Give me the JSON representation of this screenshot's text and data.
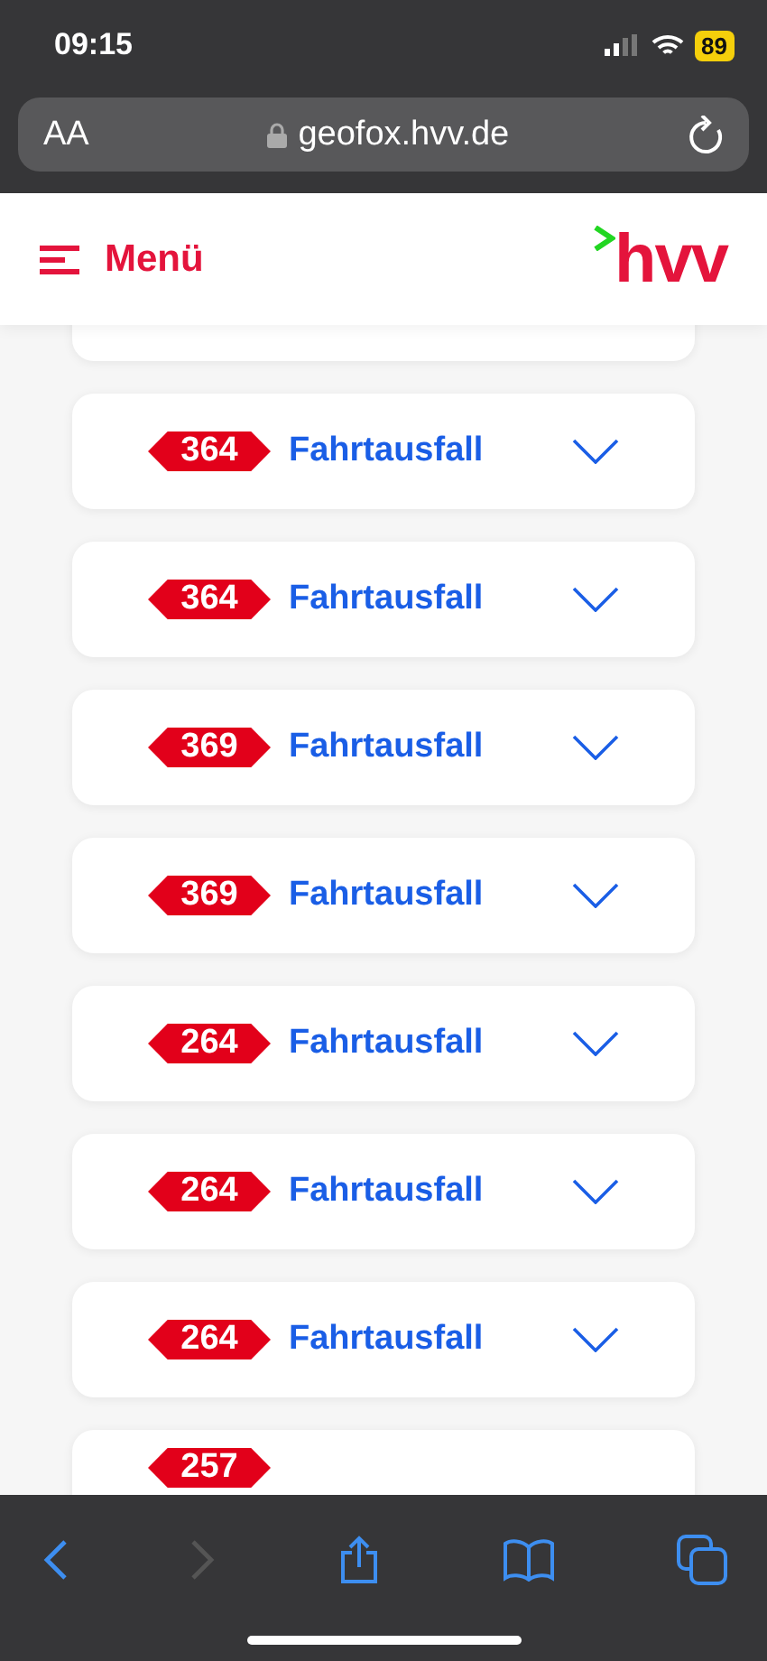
{
  "status_bar": {
    "time": "09:15",
    "battery": "89"
  },
  "browser": {
    "text_size": "AA",
    "url": "geofox.hvv.de",
    "back_disabled": false,
    "forward_disabled": true
  },
  "header": {
    "menu_label": "Menü",
    "logo": "hvv"
  },
  "card_cut_above": true,
  "disruptions": [
    {
      "line": "364",
      "title": "Fahrtausfall",
      "expanded": false
    },
    {
      "line": "364",
      "title": "Fahrtausfall",
      "expanded": false
    },
    {
      "line": "369",
      "title": "Fahrtausfall",
      "expanded": false
    },
    {
      "line": "369",
      "title": "Fahrtausfall",
      "expanded": false
    },
    {
      "line": "264",
      "title": "Fahrtausfall",
      "expanded": false
    },
    {
      "line": "264",
      "title": "Fahrtausfall",
      "expanded": false
    },
    {
      "line": "264",
      "title": "Fahrtausfall",
      "expanded": false
    },
    {
      "line": "257"
    }
  ]
}
